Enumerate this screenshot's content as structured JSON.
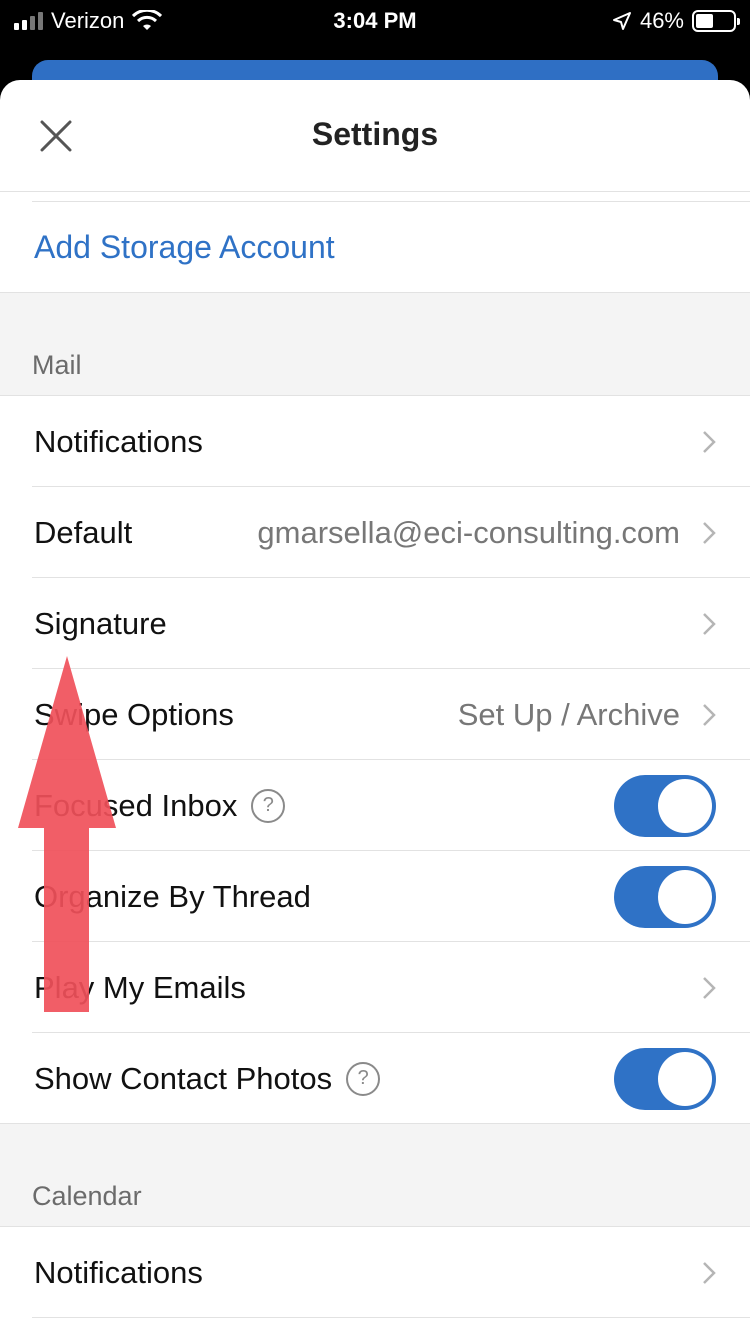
{
  "status_bar": {
    "carrier": "Verizon",
    "time": "3:04 PM",
    "battery": "46%",
    "battery_level": 0.46
  },
  "header": {
    "title": "Settings"
  },
  "storage": {
    "add_label": "Add Storage Account"
  },
  "mail": {
    "section_label": "Mail",
    "notifications": "Notifications",
    "default_label": "Default",
    "default_value": "gmarsella@eci-consulting.com",
    "signature": "Signature",
    "swipe_label": "Swipe Options",
    "swipe_value": "Set Up / Archive",
    "focused_inbox": "Focused Inbox",
    "focused_inbox_on": true,
    "organize_by_thread": "Organize By Thread",
    "organize_by_thread_on": true,
    "play_my_emails": "Play My Emails",
    "show_contact_photos": "Show Contact Photos",
    "show_contact_photos_on": true,
    "help_glyph": "?"
  },
  "calendar": {
    "section_label": "Calendar",
    "notifications": "Notifications"
  },
  "colors": {
    "accent": "#2f72c6",
    "annotation_arrow": "#f0505a"
  }
}
